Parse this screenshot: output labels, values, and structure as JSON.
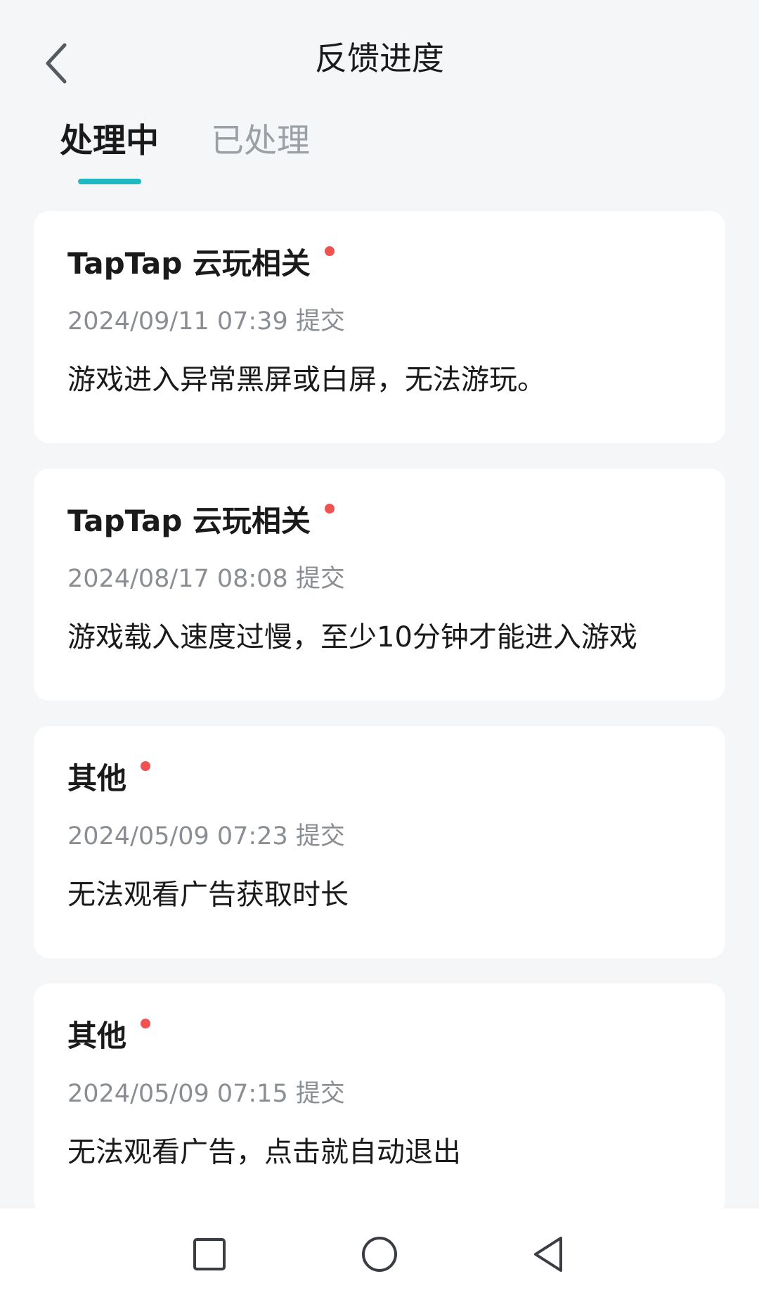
{
  "header": {
    "title": "反馈进度",
    "back_icon": "chevron-left-icon"
  },
  "tabs": [
    {
      "label": "处理中",
      "active": true
    },
    {
      "label": "已处理",
      "active": false
    }
  ],
  "colors": {
    "accent": "#1FB8C3",
    "unread_dot": "#F05252",
    "background": "#F5F6F8"
  },
  "feedback_items": [
    {
      "title": "TapTap 云玩相关",
      "time": "2024/09/11 07:39 提交",
      "description": "游戏进入异常黑屏或白屏，无法游玩。",
      "unread": true
    },
    {
      "title": "TapTap 云玩相关",
      "time": "2024/08/17 08:08 提交",
      "description": "游戏载入速度过慢，至少10分钟才能进入游戏",
      "unread": true
    },
    {
      "title": "其他",
      "time": "2024/05/09 07:23 提交",
      "description": "无法观看广告获取时长",
      "unread": true
    },
    {
      "title": "其他",
      "time": "2024/05/09 07:15 提交",
      "description": "无法观看广告，点击就自动退出",
      "unread": true
    }
  ],
  "navbar": {
    "recent_icon": "square-icon",
    "home_icon": "circle-icon",
    "back_icon": "triangle-back-icon"
  }
}
